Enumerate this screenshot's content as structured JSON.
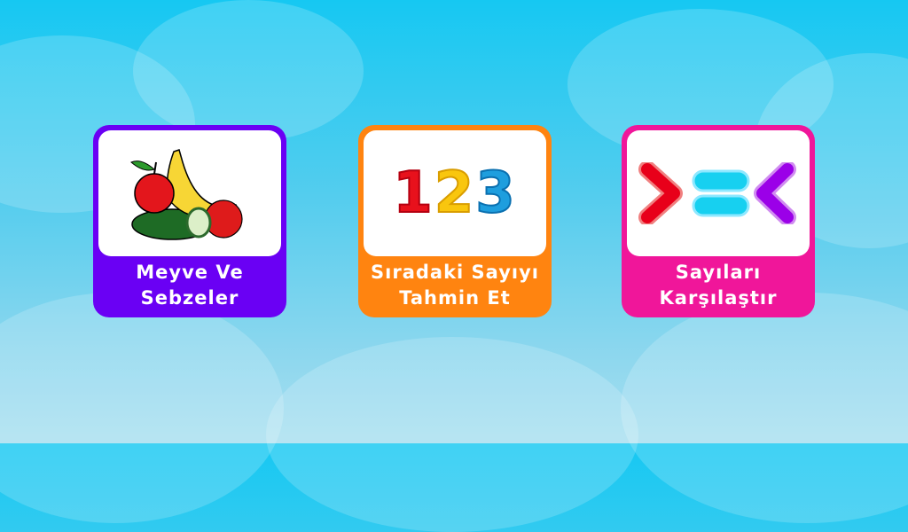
{
  "cards": [
    {
      "line1": "Meyve Ve",
      "line2": "Sebzeler",
      "color": "#6a00f4",
      "icon": "fruits-vegetables-icon"
    },
    {
      "line1": "Sıradaki Sayıyı",
      "line2": "Tahmin Et",
      "color": "#ff8410",
      "icon": "numbers-123-icon",
      "digits": [
        "1",
        "2",
        "3"
      ]
    },
    {
      "line1": "Sayıları",
      "line2": "Karşılaştır",
      "color": "#f0169a",
      "icon": "compare-symbols-icon"
    }
  ]
}
